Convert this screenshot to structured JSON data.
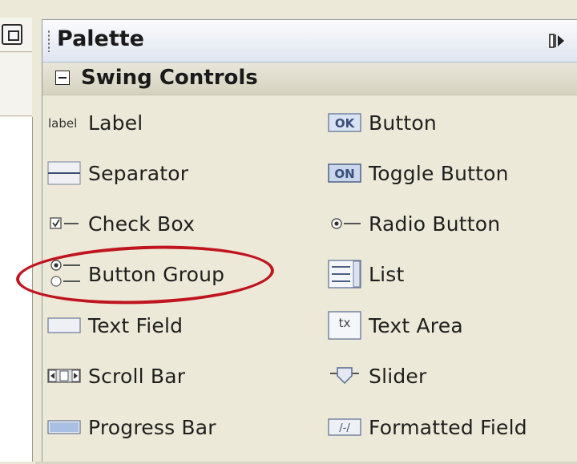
{
  "palette": {
    "title": "Palette",
    "section": {
      "title": "Swing Controls"
    },
    "left_column": [
      {
        "label": "Label",
        "icon": "label-icon"
      },
      {
        "label": "Separator",
        "icon": "separator-icon"
      },
      {
        "label": "Check Box",
        "icon": "check-box-icon"
      },
      {
        "label": "Button Group",
        "icon": "button-group-icon"
      },
      {
        "label": "Text Field",
        "icon": "text-field-icon"
      },
      {
        "label": "Scroll Bar",
        "icon": "scroll-bar-icon"
      },
      {
        "label": "Progress Bar",
        "icon": "progress-bar-icon"
      }
    ],
    "right_column": [
      {
        "label": "Button",
        "icon": "button-icon"
      },
      {
        "label": "Toggle Button",
        "icon": "toggle-button-icon"
      },
      {
        "label": "Radio Button",
        "icon": "radio-button-icon"
      },
      {
        "label": "List",
        "icon": "list-icon"
      },
      {
        "label": "Text Area",
        "icon": "text-area-icon"
      },
      {
        "label": "Slider",
        "icon": "slider-icon"
      },
      {
        "label": "Formatted Field",
        "icon": "formatted-field-icon"
      }
    ],
    "icon_text": {
      "label": "label",
      "button": "OK",
      "toggle": "ON",
      "textarea": "tx",
      "formatted": "/-/"
    }
  },
  "colors": {
    "highlight_circle": "#c0141f",
    "background": "#ece9d8"
  }
}
